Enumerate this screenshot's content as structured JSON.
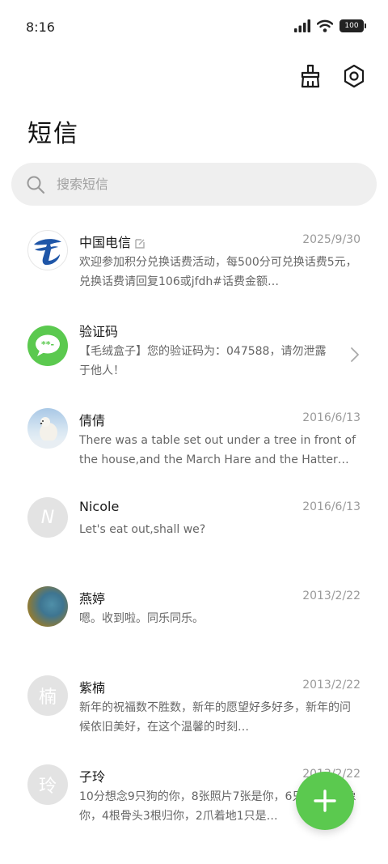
{
  "status_bar": {
    "time": "8:16",
    "battery": "100"
  },
  "header": {
    "title": "短信",
    "clean_icon": "broom-icon",
    "settings_icon": "settings-hex-icon"
  },
  "search": {
    "placeholder": "搜索短信"
  },
  "messages": [
    {
      "name": "中国电信",
      "date": "2025/9/30",
      "preview": "欢迎参加积分兑换话费活动，每500分可兑换话费5元，兑换话费请回复106或jfdh#话费金额…",
      "avatar": "china-telecom-logo"
    },
    {
      "name": "验证码",
      "date": "",
      "preview": "【毛绒盒子】您的验证码为：047588，请勿泄露于他人！",
      "avatar": "message-bubble-icon"
    },
    {
      "name": "倩倩",
      "date": "2016/6/13",
      "preview": "There was a table set out under a tree in front of the house,and the March Hare and the Hatter w…",
      "avatar": "polar-bear-photo"
    },
    {
      "name": "Nicole",
      "date": "2016/6/13",
      "preview": "Let's eat out,shall we?",
      "avatar_letter": "N"
    },
    {
      "name": "燕婷",
      "date": "2013/2/22",
      "preview": "嗯。收到啦。同乐同乐。",
      "avatar": "landscape-photo"
    },
    {
      "name": "紫楠",
      "date": "2013/2/22",
      "preview": "新年的祝福数不胜数，新年的愿望好多好多，新年的问候依旧美好，在这个温馨的时刻…",
      "avatar_letter": "楠"
    },
    {
      "name": "子玲",
      "date": "2013/2/22",
      "preview": "10分想念9只狗的你，8张照片7张是你，6只小狗5只像你，4根骨头3根归你，2爪着地1只是…",
      "avatar_letter": "玲"
    }
  ],
  "fab": {
    "icon": "plus-icon"
  },
  "colors": {
    "accent_green": "#5bc94f",
    "telecom_blue": "#1f56a8",
    "search_bg": "#efefef",
    "placeholder_avatar": "#e3e3e3"
  }
}
